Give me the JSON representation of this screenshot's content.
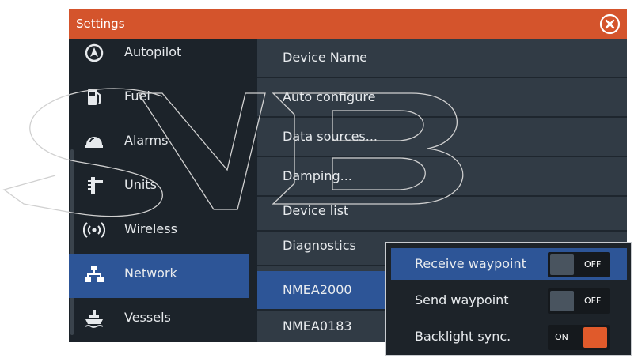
{
  "window": {
    "title": "Settings"
  },
  "sidebar": {
    "items": [
      {
        "label": "Autopilot",
        "icon": "autopilot-icon"
      },
      {
        "label": "Fuel",
        "icon": "fuel-icon"
      },
      {
        "label": "Alarms",
        "icon": "alarm-icon"
      },
      {
        "label": "Units",
        "icon": "units-icon"
      },
      {
        "label": "Wireless",
        "icon": "wireless-icon"
      },
      {
        "label": "Network",
        "icon": "network-icon",
        "active": true
      },
      {
        "label": "Vessels",
        "icon": "vessels-icon"
      }
    ]
  },
  "network_menu": {
    "items": [
      "Device Name",
      "Auto configure",
      "Data sources...",
      "Damping...",
      "Device list",
      "Diagnostics",
      "NMEA2000",
      "NMEA0183"
    ],
    "active": "NMEA2000"
  },
  "nmea2000_popup": {
    "rows": [
      {
        "label": "Receive waypoint",
        "state": "OFF"
      },
      {
        "label": "Send waypoint",
        "state": "OFF"
      },
      {
        "label": "Backlight sync.",
        "state": "ON"
      }
    ]
  },
  "watermark": {
    "text": "SVB"
  },
  "colors": {
    "titlebar": "#d4542c",
    "accent": "#2d5597",
    "toggle_on": "#e05a2b",
    "panel": "#1b232b"
  }
}
